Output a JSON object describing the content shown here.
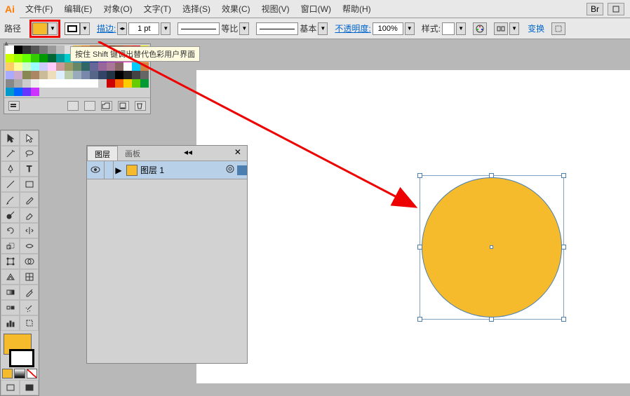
{
  "menu": {
    "file": "文件(F)",
    "edit": "编辑(E)",
    "object": "对象(O)",
    "type": "文字(T)",
    "select": "选择(S)",
    "effect": "效果(C)",
    "view": "视图(V)",
    "window": "窗口(W)",
    "help": "帮助(H)",
    "br_label": "Br"
  },
  "controlbar": {
    "path": "路径",
    "stroke_label": "描边:",
    "stroke_weight": "1 pt",
    "proportional": "等比",
    "basic": "基本",
    "opacity_label": "不透明度:",
    "opacity_value": "100%",
    "style_label": "样式:",
    "transform": "变换"
  },
  "tooltip_text": "按住 Shift 键调出替代色彩用户界面",
  "swatches": {
    "row1": [
      "#ffffff",
      "#000000",
      "#333333",
      "#555555",
      "#777777",
      "#999999",
      "#bbbbbb",
      "#dddddd",
      "#f5bb2d",
      "#ff8800",
      "#cc5500",
      "#996633",
      "#663300",
      "#993300",
      "#cc3300",
      "#ff0000"
    ],
    "row2": [
      "#ffff00",
      "#ccff00",
      "#99ff00",
      "#66ff00",
      "#33cc00",
      "#009900",
      "#006633",
      "#009999",
      "#00cccc",
      "#0099ff",
      "#0066cc",
      "#003399",
      "#6633cc",
      "#9933cc",
      "#cc33cc",
      "#ff33cc"
    ],
    "row3": [
      "#ff6666",
      "#ff9966",
      "#ffcc66",
      "#ffff99",
      "#ccffcc",
      "#99ffff",
      "#ccccff",
      "#ffccff",
      "#cc9999",
      "#999966",
      "#668866",
      "#336666",
      "#666699",
      "#996699",
      "#aa7799",
      "#886666"
    ],
    "row4": [
      "#ffffff",
      "#00ccff",
      "#cc8844",
      "#aaaaff",
      "#ccaacc",
      "#888855",
      "#aa8866",
      "#ccbb99",
      "#eeddbb",
      "#ddeeff",
      "#bbccaa",
      "#99aabb",
      "#7788aa",
      "#556688",
      "#334466",
      "#223344"
    ],
    "row5": [
      "#000000",
      "#222222",
      "#444444",
      "#666666",
      "#888888",
      "#aaaaaa",
      "#cccccc",
      "#eeeeee",
      "#ffffff",
      "#ffffff",
      "#ffffff",
      "#ffffff",
      "#ffffff",
      "#ffffff",
      "#ffffff",
      "#cccccc"
    ],
    "row6": [
      "#cc0000",
      "#ff6600",
      "#ffcc00",
      "#66cc00",
      "#009933",
      "#0099cc",
      "#0066ff",
      "#6633ff",
      "#cc33ff"
    ]
  },
  "layers": {
    "tab_layers": "图层",
    "tab_artboards": "画板",
    "layer1_name": "图层 1"
  },
  "colors": {
    "fill": "#f5bb2d",
    "highlight": "#e00000"
  }
}
